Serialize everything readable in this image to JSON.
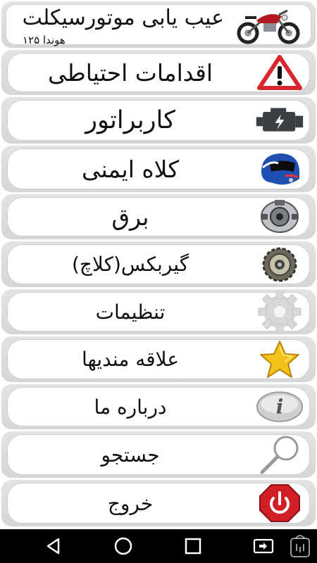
{
  "header": {
    "title": "عیب یابی موتورسیکلت",
    "subtitle": "هوندا ۱۲۵",
    "icon": "motorcycle-icon"
  },
  "menu": [
    {
      "label": "اقدامات احتیاطی",
      "icon": "warning-triangle-icon"
    },
    {
      "label": "کاربراتور",
      "icon": "engine-icon"
    },
    {
      "label": "کلاه ایمنی",
      "icon": "helmet-icon"
    },
    {
      "label": "برق",
      "icon": "electric-motor-icon"
    },
    {
      "label": "گیربکس(کلاچ)",
      "icon": "gearbox-clutch-icon"
    },
    {
      "label": "تنظیمات",
      "icon": "gear-icon"
    },
    {
      "label": "علاقه مندیها",
      "icon": "star-icon"
    },
    {
      "label": "درباره ما",
      "icon": "info-icon"
    },
    {
      "label": "جستجو",
      "icon": "magnifier-icon"
    },
    {
      "label": "خروج",
      "icon": "power-icon"
    }
  ],
  "navbar": {
    "back": "back-triangle-icon",
    "home": "home-circle-icon",
    "recents": "recents-square-icon",
    "screen_mirror": "screen-rotate-icon",
    "store_watermark": "bazaar-store-icon"
  },
  "colors": {
    "warning_red": "#d9262c",
    "engine_dark": "#3b3f44",
    "helmet_blue": "#1f4fb0",
    "star_yellow": "#f3c21a",
    "power_red": "#d11f26"
  }
}
